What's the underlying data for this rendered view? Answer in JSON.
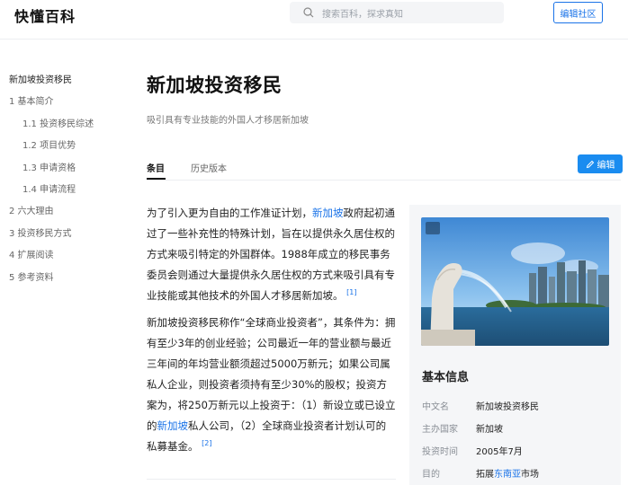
{
  "header": {
    "logo": "快懂百科",
    "search_placeholder": "搜索百科，探求真知",
    "edit_community": "编辑社区"
  },
  "toc": [
    {
      "label": "新加坡投资移民",
      "level": 0
    },
    {
      "label": "1 基本简介",
      "level": 1
    },
    {
      "label": "1.1 投资移民综述",
      "level": 2
    },
    {
      "label": "1.2 项目优势",
      "level": 2
    },
    {
      "label": "1.3 申请资格",
      "level": 2
    },
    {
      "label": "1.4 申请流程",
      "level": 2
    },
    {
      "label": "2 六大理由",
      "level": 1
    },
    {
      "label": "3 投资移民方式",
      "level": 1
    },
    {
      "label": "4 扩展阅读",
      "level": 1
    },
    {
      "label": "5 参考资料",
      "level": 1
    }
  ],
  "article": {
    "title": "新加坡投资移民",
    "subtitle": "吸引具有专业技能的外国人才移居新加坡",
    "tabs": {
      "entry": "条目",
      "history": "历史版本"
    },
    "edit_label": "编辑",
    "p1": {
      "a": "为了引入更为自由的工作准证计划，",
      "link": "新加坡",
      "b": "政府起初通过了一些补充性的特殊计划，旨在以提供永久居住权的方式来吸引特定的外国群体。1988年成立的移民事务委员会则通过大量提供永久居住权的方式来吸引具有专业技能或其他技术的外国人才移居新加坡。",
      "ref": "[1]"
    },
    "p2": {
      "a": "新加坡投资移民称作“全球商业投资者”，其条件为：拥有至少3年的创业经验；公司最近一年的营业额与最近三年间的年均营业额须超过5000万新元；如果公司属私人企业，则投资者须持有至少30%的股权；投资方案为，将250万新元以上投资于：（1）新设立或已设立的",
      "link": "新加坡",
      "b": "私人公司，（2）全球商业投资者计划认可的私募基金。",
      "ref": "[2]"
    }
  },
  "infobox": {
    "heading": "基本信息",
    "rows": [
      {
        "key": "中文名",
        "value": "新加坡投资移民"
      },
      {
        "key": "主办国家",
        "value": "新加坡"
      },
      {
        "key": "投资时间",
        "value": "2005年7月"
      },
      {
        "key": "目的",
        "value_a": "拓展",
        "value_link": "东南亚",
        "value_b": "市场"
      }
    ]
  }
}
